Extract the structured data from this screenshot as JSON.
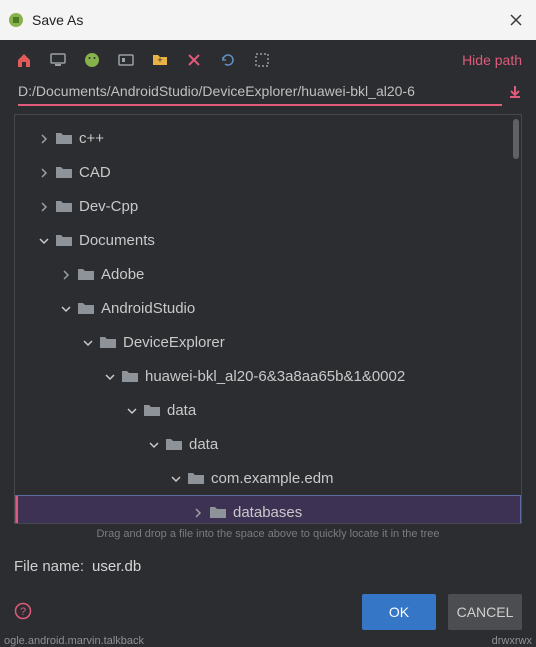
{
  "window": {
    "title": "Save As"
  },
  "toolbar": {
    "hide_path": "Hide path"
  },
  "path": {
    "value": "D:/Documents/AndroidStudio/DeviceExplorer/huawei-bkl_al20-6"
  },
  "tree": {
    "items": [
      {
        "label": "c++",
        "depth": 0,
        "expanded": false,
        "selected": false
      },
      {
        "label": "CAD",
        "depth": 0,
        "expanded": false,
        "selected": false
      },
      {
        "label": "Dev-Cpp",
        "depth": 0,
        "expanded": false,
        "selected": false
      },
      {
        "label": "Documents",
        "depth": 0,
        "expanded": true,
        "selected": false
      },
      {
        "label": "Adobe",
        "depth": 1,
        "expanded": false,
        "selected": false
      },
      {
        "label": "AndroidStudio",
        "depth": 1,
        "expanded": true,
        "selected": false
      },
      {
        "label": "DeviceExplorer",
        "depth": 2,
        "expanded": true,
        "selected": false
      },
      {
        "label": "huawei-bkl_al20-6&3a8aa65b&1&0002",
        "depth": 3,
        "expanded": true,
        "selected": false
      },
      {
        "label": "data",
        "depth": 4,
        "expanded": true,
        "selected": false
      },
      {
        "label": "data",
        "depth": 5,
        "expanded": true,
        "selected": false
      },
      {
        "label": "com.example.edm",
        "depth": 6,
        "expanded": true,
        "selected": false
      },
      {
        "label": "databases",
        "depth": 7,
        "expanded": false,
        "selected": true
      }
    ],
    "hint": "Drag and drop a file into the space above to quickly locate it in the tree"
  },
  "filename": {
    "label": "File name:",
    "value": "user.db"
  },
  "buttons": {
    "ok": "OK",
    "cancel": "CANCEL"
  },
  "bottom": {
    "left": "ogle.android.marvin.talkback",
    "right": "drwxrwx"
  },
  "colors": {
    "accent": "#e05a7a",
    "primary": "#3676c6"
  }
}
